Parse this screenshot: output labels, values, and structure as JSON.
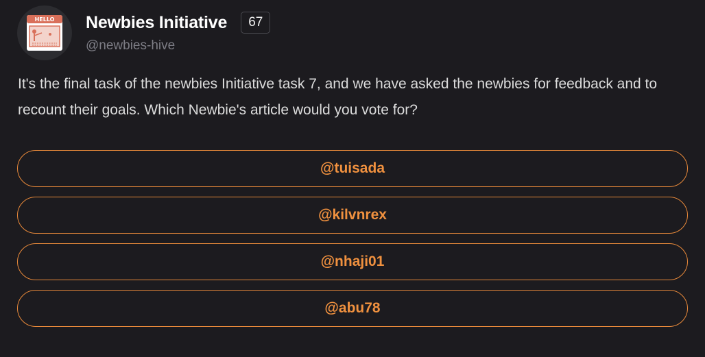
{
  "community": {
    "name": "Newbies Initiative",
    "reputation": "67",
    "handle": "@newbies-hive",
    "avatar_icon": "hello-presenter-icon",
    "avatar_text": "HELLO"
  },
  "post": {
    "question": "It's the final task of the newbies Initiative task 7, and we have asked the newbies for feedback and to recount their goals. Which Newbie's article would you vote for?"
  },
  "poll": {
    "options": [
      {
        "label": "@tuisada"
      },
      {
        "label": "@kilvnrex"
      },
      {
        "label": "@nhaji01"
      },
      {
        "label": "@abu78"
      }
    ]
  },
  "colors": {
    "background": "#1c1b1f",
    "accent": "#f0913f",
    "option_border": "#e8893a"
  }
}
